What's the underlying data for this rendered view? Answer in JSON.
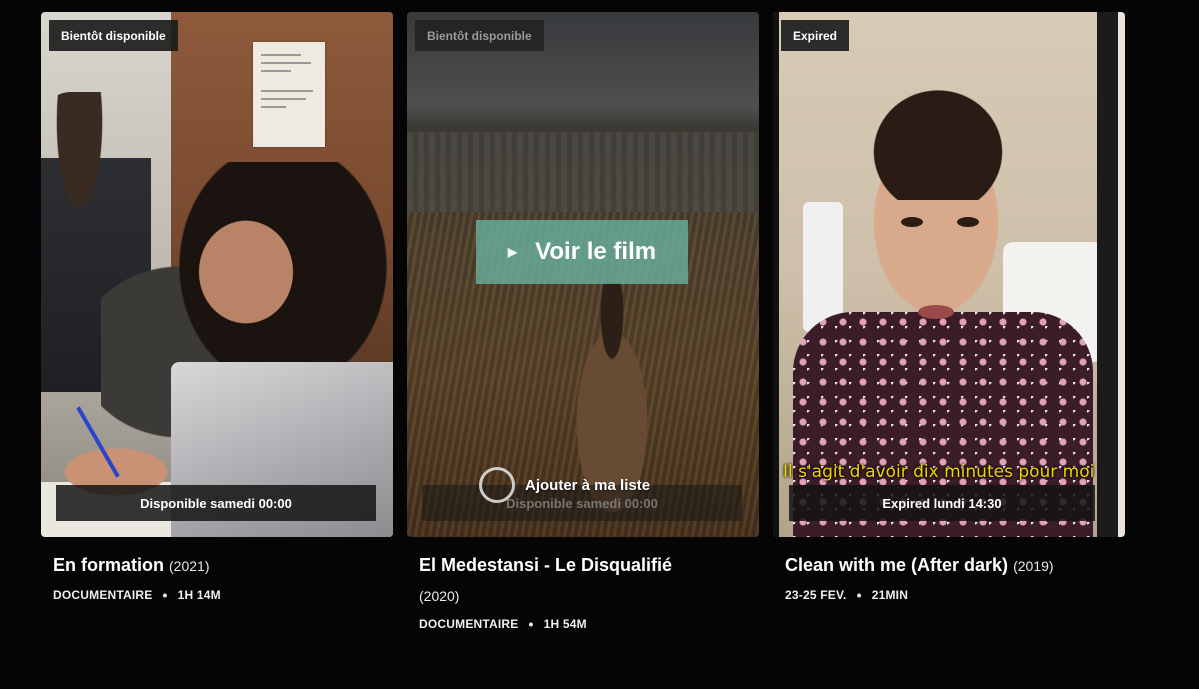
{
  "cards": [
    {
      "badge": "Bientôt disponible",
      "availability": "Disponible samedi 00:00",
      "title": "En formation",
      "year": "(2021)",
      "genre": "DOCUMENTAIRE",
      "duration": "1H 14M"
    },
    {
      "badge": "Bientôt disponible",
      "availability": "Disponible samedi 00:00",
      "title": "El Medestansi - Le Disqualifié",
      "year": "(2020)",
      "genre": "DOCUMENTAIRE",
      "duration": "1H 54M",
      "play_label": "Voir le film",
      "add_list_label": "Ajouter à ma liste"
    },
    {
      "badge": "Expired",
      "availability": "Expired lundi 14:30",
      "title": "Clean with me (After dark)",
      "year": "(2019)",
      "genre": "23-25 FEV.",
      "duration": "21MIN",
      "subtitle": "Il s'agit d'avoir dix minutes pour moi"
    }
  ],
  "separator": "•",
  "icons": {
    "play": "play-triangle-icon",
    "add": "circle-add-icon",
    "apple": "apple-logo"
  },
  "colors": {
    "background": "#050505",
    "play_button": "#68b09c",
    "subtitle": "#f0d400"
  }
}
